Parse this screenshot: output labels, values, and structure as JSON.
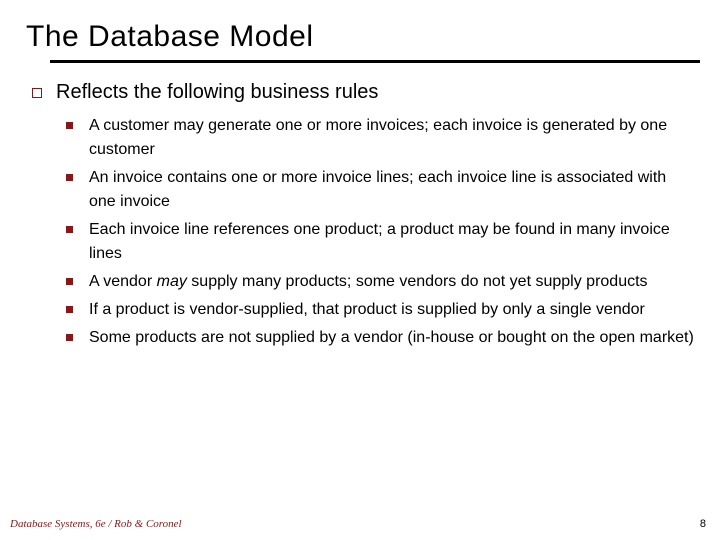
{
  "title": "The Database Model",
  "section": {
    "heading": "Reflects the following business rules",
    "items": [
      {
        "text": "A customer may generate one or more invoices; each invoice is generated by one customer",
        "emphasis": null
      },
      {
        "text": "An invoice contains one or more invoice lines; each invoice line is associated with one invoice",
        "emphasis": null
      },
      {
        "text": "Each invoice line references one product; a product may be found in many invoice lines",
        "emphasis": null
      },
      {
        "text_before": "A vendor ",
        "emphasis": "may",
        "text_after": " supply many products; some vendors do not yet supply products"
      },
      {
        "text": "If a product is vendor-supplied, that product is supplied by only a single vendor",
        "emphasis": null
      },
      {
        "text": "Some products are not supplied by a vendor (in-house or bought on the open market)",
        "emphasis": null
      }
    ]
  },
  "footer": "Database Systems, 6e / Rob & Coronel",
  "page_number": "8"
}
